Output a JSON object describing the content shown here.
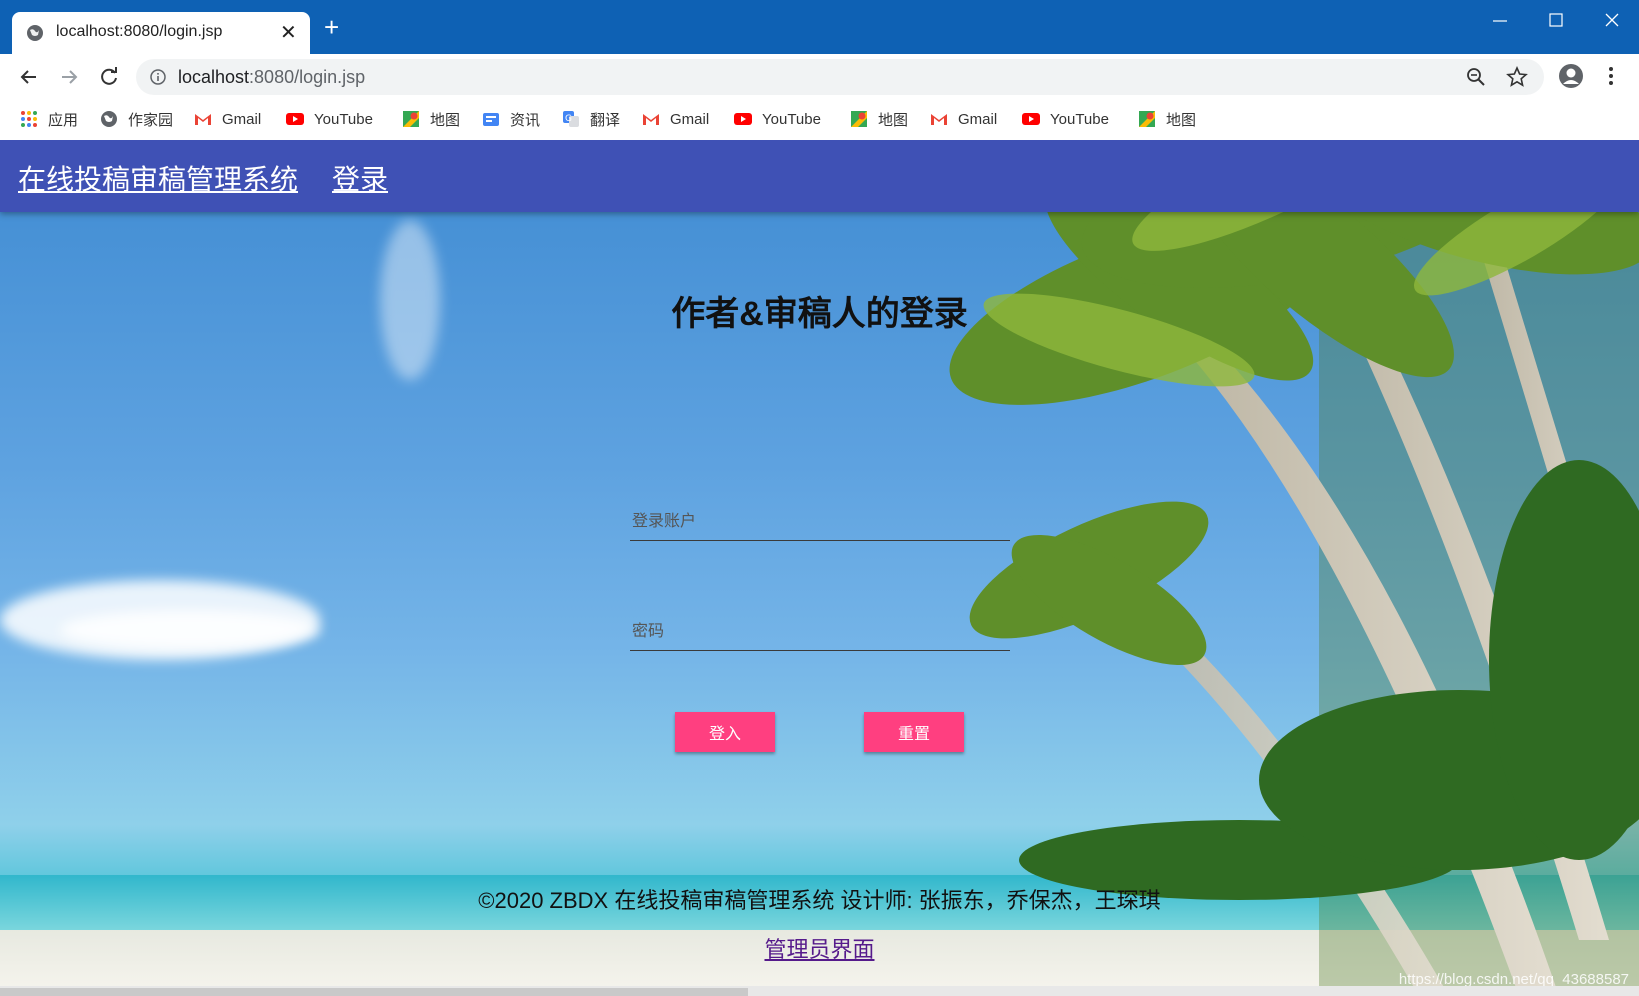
{
  "browser": {
    "tab_title": "localhost:8080/login.jsp",
    "url_host": "localhost",
    "url_rest": ":8080/login.jsp",
    "bookmarks": [
      {
        "label": "应用",
        "icon": "apps-grid-icon"
      },
      {
        "label": "作家园",
        "icon": "globe-icon"
      },
      {
        "label": "Gmail",
        "icon": "gmail-icon"
      },
      {
        "label": "YouTube",
        "icon": "youtube-icon"
      },
      {
        "label": "地图",
        "icon": "maps-icon"
      },
      {
        "label": "资讯",
        "icon": "news-icon"
      },
      {
        "label": "翻译",
        "icon": "translate-icon"
      },
      {
        "label": "Gmail",
        "icon": "gmail-icon"
      },
      {
        "label": "YouTube",
        "icon": "youtube-icon"
      },
      {
        "label": "地图",
        "icon": "maps-icon"
      },
      {
        "label": "Gmail",
        "icon": "gmail-icon"
      },
      {
        "label": "YouTube",
        "icon": "youtube-icon"
      },
      {
        "label": "地图",
        "icon": "maps-icon"
      }
    ]
  },
  "appbar": {
    "brand": "在线投稿审稿管理系统",
    "login_link": "登录",
    "color": "#3f51b5"
  },
  "login": {
    "heading": "作者&审稿人的登录",
    "account_placeholder": "登录账户",
    "password_placeholder": "密码",
    "login_button": "登入",
    "reset_button": "重置",
    "button_color": "#ff3f80"
  },
  "footer": {
    "copyright": "©2020 ZBDX 在线投稿审稿管理系统 设计师: 张振东，乔保杰，王琛琪",
    "admin_link": "管理员界面",
    "watermark": "https://blog.csdn.net/qq_43688587"
  }
}
